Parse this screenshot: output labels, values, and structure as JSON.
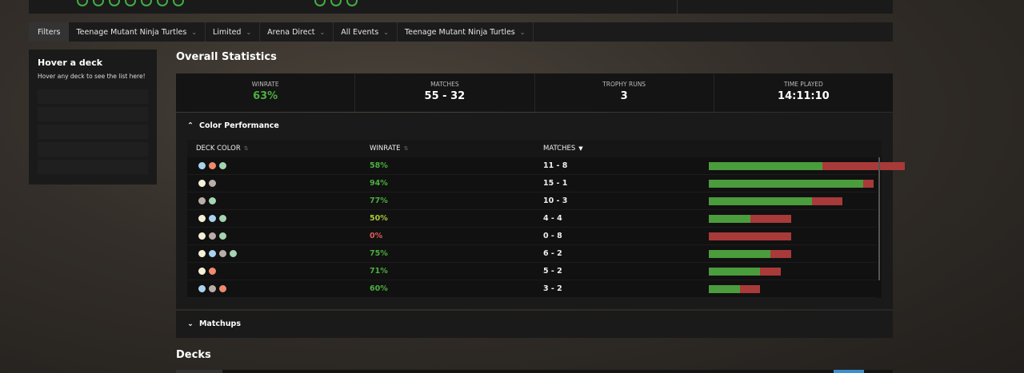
{
  "filters": {
    "label": "Filters",
    "items": [
      {
        "label": "Teenage Mutant Ninja Turtles"
      },
      {
        "label": "Limited"
      },
      {
        "label": "Arena Direct"
      },
      {
        "label": "All Events"
      },
      {
        "label": "Teenage Mutant Ninja Turtles"
      }
    ],
    "chevron_icon": "chevron-down-icon"
  },
  "hover_panel": {
    "title": "Hover a deck",
    "subtitle": "Hover any deck to see the list here!"
  },
  "overall": {
    "title": "Overall Statistics",
    "stats": [
      {
        "label": "WINRATE",
        "value": "63%"
      },
      {
        "label": "MATCHES",
        "value": "55 - 32"
      },
      {
        "label": "TROPHY RUNS",
        "value": "3"
      },
      {
        "label": "TIME PLAYED",
        "value": "14:11:10"
      }
    ]
  },
  "color_performance": {
    "title": "Color Performance",
    "headers": {
      "deck_color": "DECK COLOR",
      "winrate": "WINRATE",
      "matches": "MATCHES"
    },
    "rows": [
      {
        "colors": [
          "U",
          "R",
          "G"
        ],
        "winrate": "58%",
        "matches": "11 - 8",
        "wins": 11,
        "losses": 8
      },
      {
        "colors": [
          "W",
          "B"
        ],
        "winrate": "94%",
        "matches": "15 - 1",
        "wins": 15,
        "losses": 1
      },
      {
        "colors": [
          "B",
          "G"
        ],
        "winrate": "77%",
        "matches": "10 - 3",
        "wins": 10,
        "losses": 3
      },
      {
        "colors": [
          "W",
          "U",
          "G"
        ],
        "winrate": "50%",
        "matches": "4 - 4",
        "wins": 4,
        "losses": 4
      },
      {
        "colors": [
          "W",
          "B",
          "G"
        ],
        "winrate": "0%",
        "matches": "0 - 8",
        "wins": 0,
        "losses": 8
      },
      {
        "colors": [
          "W",
          "U",
          "B",
          "G"
        ],
        "winrate": "75%",
        "matches": "6 - 2",
        "wins": 6,
        "losses": 2
      },
      {
        "colors": [
          "W",
          "R"
        ],
        "winrate": "71%",
        "matches": "5 - 2",
        "wins": 5,
        "losses": 2
      },
      {
        "colors": [
          "U",
          "B",
          "R"
        ],
        "winrate": "60%",
        "matches": "3 - 2",
        "wins": 3,
        "losses": 2
      }
    ]
  },
  "matchups": {
    "title": "Matchups"
  },
  "decks": {
    "title": "Decks"
  },
  "colors": {
    "win_green": "#4a9c3c",
    "loss_red": "#a83a3a",
    "accent_blue": "#3a8fd0"
  }
}
